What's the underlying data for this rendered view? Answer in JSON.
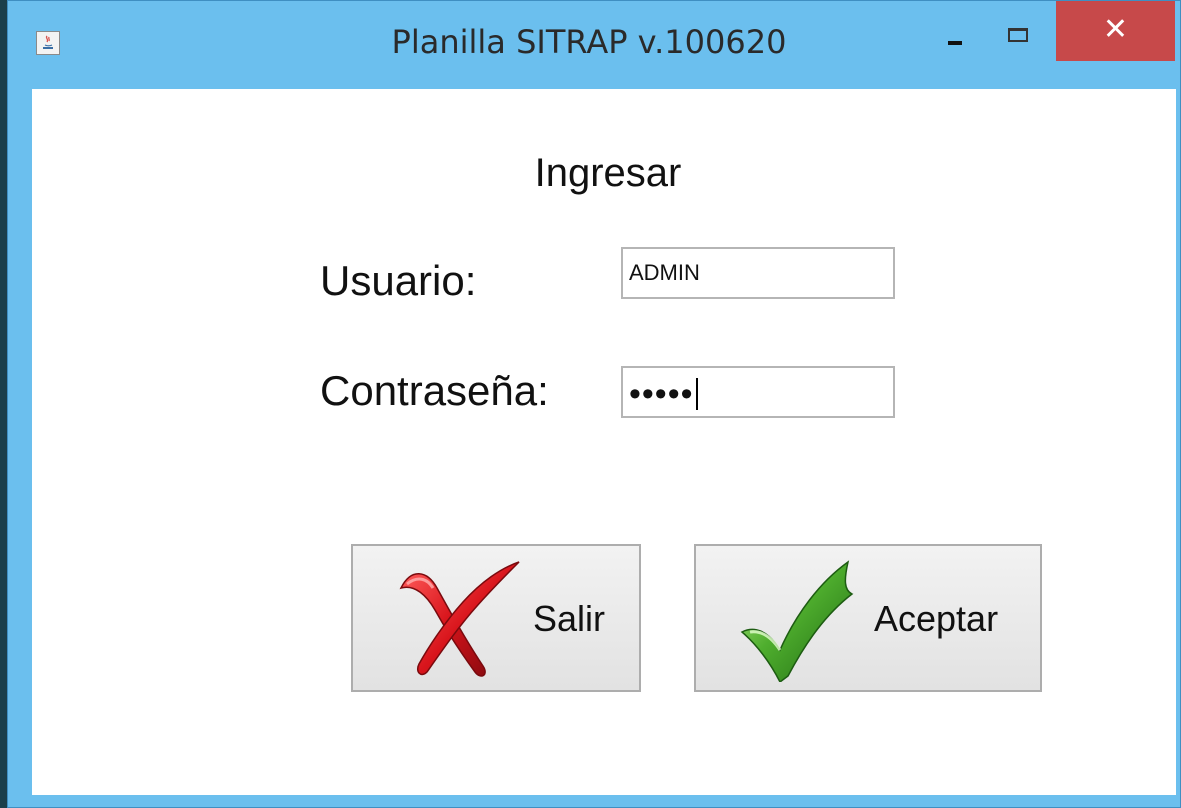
{
  "window": {
    "title": "Planilla SITRAP v.100620",
    "close_label": "✕",
    "icons": [
      "java-app-icon",
      "minimize-icon",
      "maximize-icon",
      "close-icon"
    ]
  },
  "login": {
    "heading": "Ingresar",
    "user_label": "Usuario:",
    "user_value": "ADMIN",
    "password_label": "Contraseña:",
    "password_masked": "•••••"
  },
  "buttons": {
    "exit_label": "Salir",
    "exit_icon": "red-x-icon",
    "accept_label": "Aceptar",
    "accept_icon": "green-check-icon"
  },
  "colors": {
    "titlebar": "#6bbfee",
    "close": "#c7494a"
  }
}
